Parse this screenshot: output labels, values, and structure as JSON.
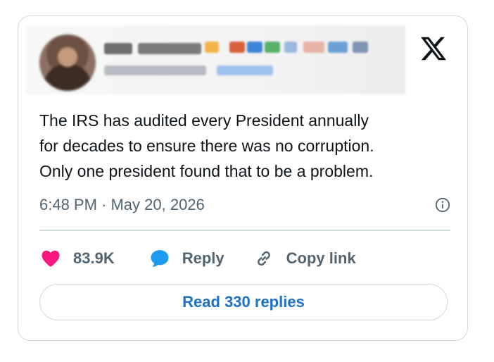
{
  "tweet": {
    "text_lines": [
      "The IRS has audited every President annually",
      "for decades to ensure there was no corruption.",
      "Only one president found that to be a problem."
    ],
    "timestamp": "6:48 PM · May 20, 2026"
  },
  "actions": {
    "likes_count": "83.9K",
    "reply_label": "Reply",
    "copy_link_label": "Copy link"
  },
  "read_replies_label": "Read 330 replies",
  "colors": {
    "like": "#f91880",
    "reply": "#1d9bf0",
    "link_text": "#1d70c8",
    "muted_text": "#536471",
    "border": "#cfd9de"
  },
  "icons": [
    "x-logo",
    "info-icon",
    "heart-icon",
    "reply-bubble-icon",
    "link-icon"
  ]
}
